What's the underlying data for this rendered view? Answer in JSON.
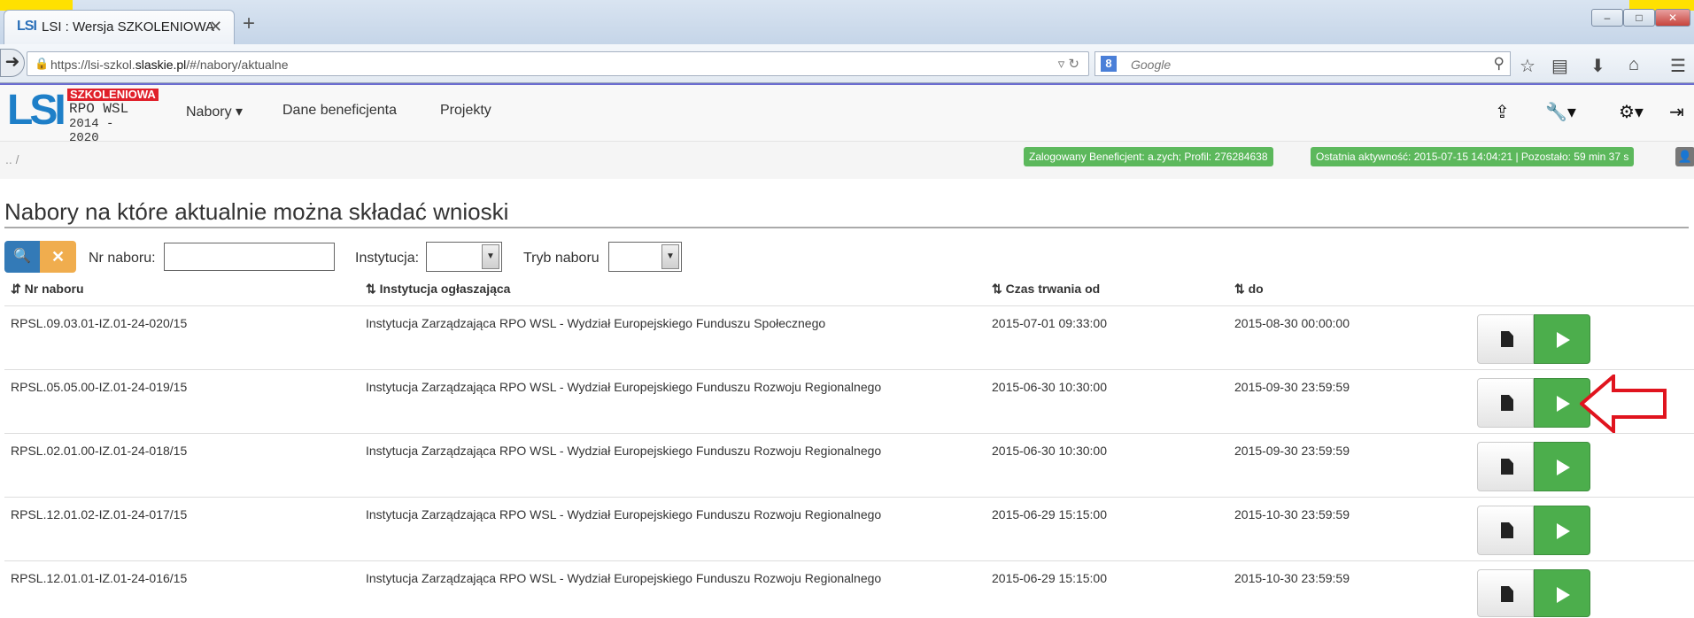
{
  "browser": {
    "tab_title": "LSI : Wersja SZKOLENIOWA",
    "tab_logo": "LSI",
    "url_prefix": "https://lsi-szkol.",
    "url_domain": "slaskie.pl",
    "url_path": "/#/nabory/aktualne",
    "search_placeholder": "Google"
  },
  "app": {
    "logo_lsi": "LSI",
    "logo_badge": "SZKOLENIOWA",
    "logo_program": "RPO WSL",
    "logo_years": "2014 - 2020",
    "menu": [
      {
        "label": "Nabory ▾"
      },
      {
        "label": "Dane beneficjenta"
      },
      {
        "label": "Projekty"
      }
    ],
    "breadcrumb": ".. /",
    "badge_user": "Zalogowany Beneficjent: a.zych; Profil: 276284638",
    "badge_activity": "Ostatnia aktywność: 2015-07-15 14:04:21 | Pozostało: 59 min 37 s"
  },
  "page": {
    "title": "Nabory na które aktualnie można składać wnioski",
    "filters": {
      "nr_label": "Nr naboru:",
      "inst_label": "Instytucja:",
      "tryb_label": "Tryb naboru"
    },
    "columns": [
      "Nr naboru",
      "Instytucja ogłaszająca",
      "Czas trwania od",
      "do"
    ],
    "rows": [
      {
        "nr": "RPSL.09.03.01-IZ.01-24-020/15",
        "inst": "Instytucja Zarządzająca RPO WSL - Wydział Europejskiego Funduszu Społecznego",
        "od": "2015-07-01 09:33:00",
        "do": "2015-08-30 00:00:00"
      },
      {
        "nr": "RPSL.05.05.00-IZ.01-24-019/15",
        "inst": "Instytucja Zarządzająca RPO WSL - Wydział Europejskiego Funduszu Rozwoju Regionalnego",
        "od": "2015-06-30 10:30:00",
        "do": "2015-09-30 23:59:59"
      },
      {
        "nr": "RPSL.02.01.00-IZ.01-24-018/15",
        "inst": "Instytucja Zarządzająca RPO WSL - Wydział Europejskiego Funduszu Rozwoju Regionalnego",
        "od": "2015-06-30 10:30:00",
        "do": "2015-09-30 23:59:59"
      },
      {
        "nr": "RPSL.12.01.02-IZ.01-24-017/15",
        "inst": "Instytucja Zarządzająca RPO WSL - Wydział Europejskiego Funduszu Rozwoju Regionalnego",
        "od": "2015-06-29 15:15:00",
        "do": "2015-10-30 23:59:59"
      },
      {
        "nr": "RPSL.12.01.01-IZ.01-24-016/15",
        "inst": "Instytucja Zarządzająca RPO WSL - Wydział Europejskiego Funduszu Rozwoju Regionalnego",
        "od": "2015-06-29 15:15:00",
        "do": "2015-10-30 23:59:59"
      }
    ]
  },
  "colors": {
    "accent": "#337ab7",
    "success": "#5cb85c",
    "warning": "#f0ad4e",
    "annotation": "#e0141e"
  }
}
